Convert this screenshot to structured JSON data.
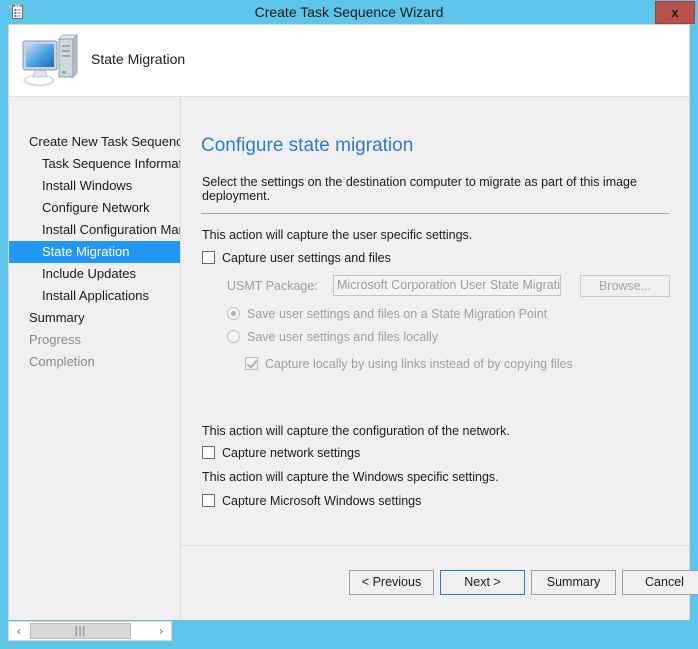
{
  "window": {
    "title": "Create Task Sequence Wizard",
    "title_icon": "task-list-clipboard-icon",
    "close_label": "x",
    "accent_color": "#5dc5ea",
    "close_color": "#b6514b"
  },
  "banner": {
    "icon": "computer-icon",
    "title": "State Migration"
  },
  "sidebar": {
    "items": [
      {
        "label": "Create New Task Sequence",
        "level": 1,
        "state": "normal"
      },
      {
        "label": "Task Sequence Information",
        "level": 2,
        "state": "normal"
      },
      {
        "label": "Install Windows",
        "level": 2,
        "state": "normal"
      },
      {
        "label": "Configure Network",
        "level": 2,
        "state": "normal"
      },
      {
        "label": "Install Configuration Manager",
        "level": 2,
        "state": "normal"
      },
      {
        "label": "State Migration",
        "level": 2,
        "state": "selected"
      },
      {
        "label": "Include Updates",
        "level": 2,
        "state": "normal"
      },
      {
        "label": "Install Applications",
        "level": 2,
        "state": "normal"
      },
      {
        "label": "Summary",
        "level": 1,
        "state": "normal"
      },
      {
        "label": "Progress",
        "level": 1,
        "state": "dim"
      },
      {
        "label": "Completion",
        "level": 1,
        "state": "dim"
      }
    ],
    "selected_color": "#2196f3"
  },
  "content": {
    "page_title": "Configure state migration",
    "intro": "Select the settings on the destination computer to migrate as part of this image deployment.",
    "user_section_text": "This action will capture the user specific settings.",
    "capture_user": {
      "label": "Capture user settings and files",
      "checked": false,
      "disabled": false
    },
    "usmt": {
      "label": "USMT Package:",
      "value": "Microsoft Corporation User State Migration Tool",
      "browse_label": "Browse...",
      "disabled": true
    },
    "radios": [
      {
        "label": "Save user settings and files on a State Migration Point",
        "selected": true,
        "disabled": true
      },
      {
        "label": "Save user settings and files locally",
        "selected": false,
        "disabled": true
      }
    ],
    "capture_links": {
      "label": "Capture locally by using links instead of by copying files",
      "checked": true,
      "disabled": true
    },
    "network_section_text": "This action will capture the configuration of the network.",
    "capture_network": {
      "label": "Capture network settings",
      "checked": false,
      "disabled": false
    },
    "windows_section_text": "This action will capture the Windows specific settings.",
    "capture_windows": {
      "label": "Capture Microsoft Windows settings",
      "checked": false,
      "disabled": false
    }
  },
  "footer": {
    "previous_label": "< Previous",
    "next_label": "Next >",
    "summary_label": "Summary",
    "cancel_label": "Cancel",
    "focused_button": "next"
  },
  "scrollbar": {
    "left_arrow": "‹",
    "right_arrow": "›",
    "grip": "|||"
  }
}
